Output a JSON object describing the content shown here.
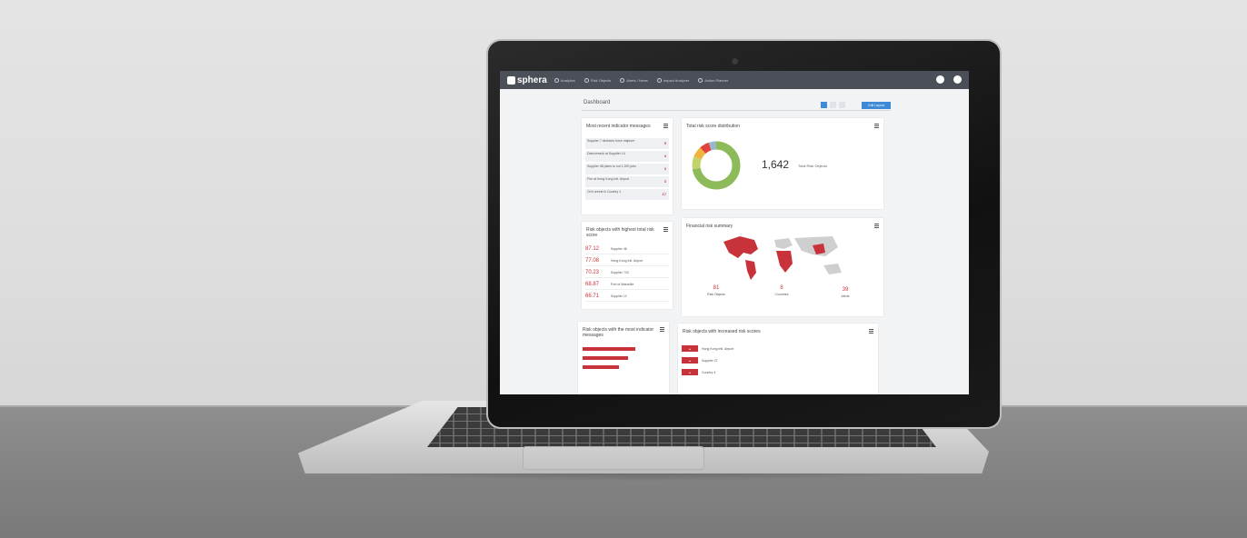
{
  "app": {
    "brand": "sphera",
    "nav": [
      "Analytics",
      "Risk Objects",
      "Alerts / News",
      "Impact Analyzer",
      "Action Planner"
    ]
  },
  "dashboard": {
    "title": "Dashboard",
    "edit_label": "Edit Layout"
  },
  "indicator_messages": {
    "title": "Most recent indicator messages",
    "items": [
      {
        "text": "Supplier 7 declares force majeure",
        "count": "5"
      },
      {
        "text": "Data breach at Supplier 14",
        "count": "4"
      },
      {
        "text": "Supplier 48 plans to cut 1,200 jobs",
        "count": "3"
      },
      {
        "text": "Fire at Hong Kong Intl. Airport",
        "count": "3"
      },
      {
        "text": "Civil unrest in Country 1",
        "count": "17"
      }
    ]
  },
  "total_risk": {
    "title": "Total risk score distribution",
    "total": "1,642",
    "total_label": "Total Risk Objects"
  },
  "highest_risk": {
    "title": "Risk objects with highest total risk score",
    "items": [
      {
        "score": "87.12",
        "name": "Supplier 46"
      },
      {
        "score": "77.08",
        "name": "Hong Kong Intl. Airport"
      },
      {
        "score": "70.23",
        "name": "Supplier 743"
      },
      {
        "score": "68.87",
        "name": "Port of Marseille"
      },
      {
        "score": "66.71",
        "name": "Supplier 12"
      }
    ]
  },
  "financial": {
    "title": "Financial risk summary",
    "stats": [
      {
        "value": "81",
        "label": "Risk Objects"
      },
      {
        "value": "8",
        "label": "Countries"
      },
      {
        "value": "39",
        "label": "Alerts"
      }
    ]
  },
  "most_indicator": {
    "title": "Risk objects with the most indicator messages"
  },
  "increased_risk": {
    "title": "Risk objects with increased risk scores",
    "items": [
      {
        "name": "Hong Kong Intl. Airport"
      },
      {
        "name": "Supplier 27"
      },
      {
        "name": "Country 4"
      }
    ]
  }
}
